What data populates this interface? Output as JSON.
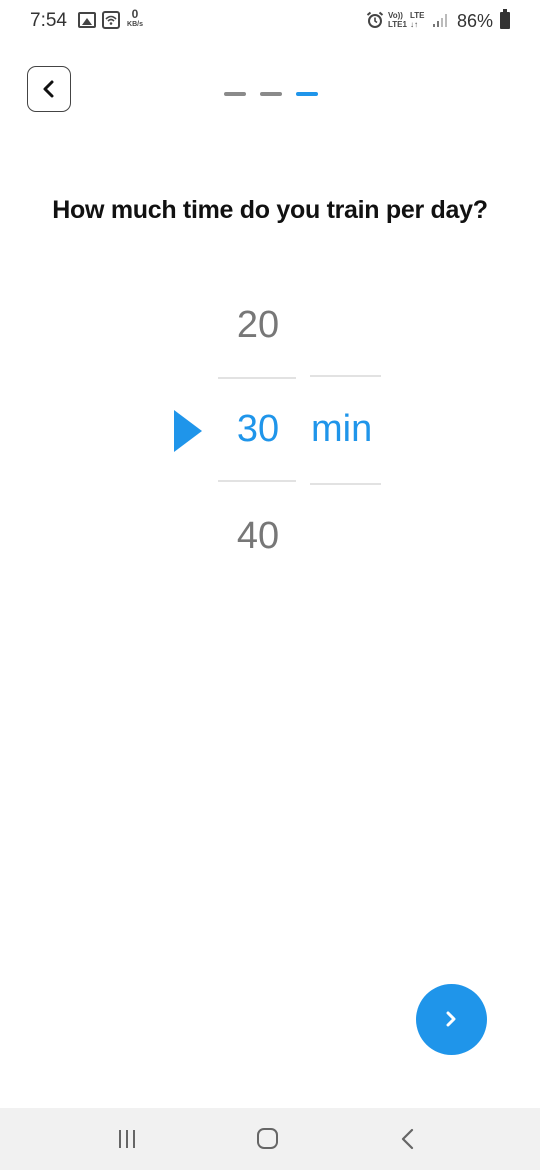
{
  "status_bar": {
    "time": "7:54",
    "data_rate_value": "0",
    "data_rate_unit": "KB/s",
    "volte_label_top": "Vo))",
    "volte_label_bottom": "LTE1",
    "lte_label_top": "LTE",
    "lte_label_bottom": "↓↑",
    "battery_percent": "86%",
    "icons": [
      "gallery-icon",
      "wifi-icon",
      "alarm-icon",
      "signal-icon",
      "battery-icon"
    ]
  },
  "header": {
    "back_icon": "chevron-left-icon",
    "progress": {
      "total_steps": 3,
      "current_step": 3
    }
  },
  "question": "How much time do you train per day?",
  "picker": {
    "previous_value": "20",
    "selected_value": "30",
    "next_value": "40",
    "unit": "min"
  },
  "next_button": {
    "icon": "chevron-right-icon"
  },
  "nav_bar": {
    "icons": [
      "recent-apps-icon",
      "home-icon",
      "back-icon"
    ]
  },
  "colors": {
    "accent": "#1f95ea",
    "inactive_step": "#8a8a8a",
    "muted_value": "#777777",
    "divider": "#e2e2e2",
    "nav_background": "#f1f1f1"
  }
}
